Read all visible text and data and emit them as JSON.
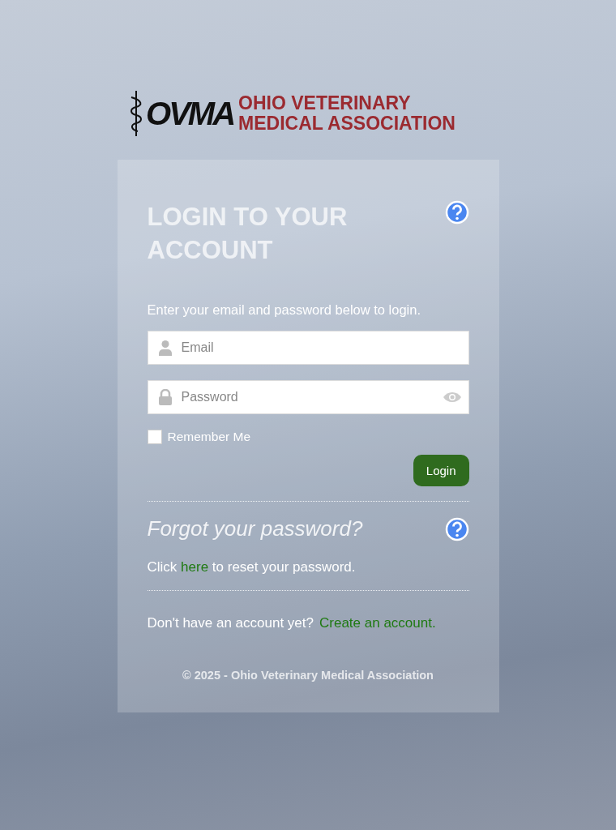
{
  "logo": {
    "mark": "OVMA",
    "name_lines": [
      "OHIO VETERINARY",
      "MEDICAL ASSOCIATION"
    ]
  },
  "login": {
    "title": "LOGIN TO YOUR ACCOUNT",
    "instructions": "Enter your email and password below to login.",
    "email": {
      "placeholder": "Email"
    },
    "password": {
      "placeholder": "Password"
    },
    "remember": {
      "label": "Remember Me",
      "checked": false
    },
    "button": "Login"
  },
  "forgot": {
    "title": "Forgot your password?",
    "before": "Click ",
    "link": "here",
    "after": " to reset your password."
  },
  "signup": {
    "text": "Don't have an account yet?",
    "link": "Create an account."
  },
  "footer": "© 2025 - Ohio Veterinary Medical Association"
}
